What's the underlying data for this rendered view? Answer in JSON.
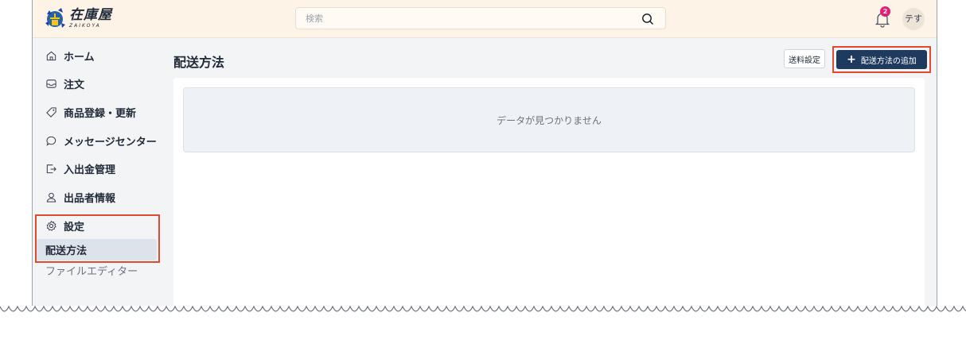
{
  "header": {
    "logo_main": "在庫屋",
    "logo_sub": "ZAIKOYA",
    "search_placeholder": "検索",
    "notification_count": "2",
    "avatar_label": "テす"
  },
  "sidebar": {
    "items": [
      {
        "label": "ホーム",
        "icon": "home-icon"
      },
      {
        "label": "注文",
        "icon": "inbox-icon"
      },
      {
        "label": "商品登録・更新",
        "icon": "tag-icon"
      },
      {
        "label": "メッセージセンター",
        "icon": "chat-icon"
      },
      {
        "label": "入出金管理",
        "icon": "transfer-icon"
      },
      {
        "label": "出品者情報",
        "icon": "user-icon"
      },
      {
        "label": "設定",
        "icon": "gear-icon"
      }
    ],
    "sub_items": [
      {
        "label": "配送方法",
        "active": true
      },
      {
        "label": "ファイルエディター",
        "active": false
      }
    ]
  },
  "main": {
    "title": "配送方法",
    "fee_button": "送料設定",
    "add_button": "配送方法の追加",
    "empty_message": "データが見つかりません"
  },
  "colors": {
    "header_bg": "#fdf3e6",
    "primary_button": "#1e3a5f",
    "highlight": "#e04a2f",
    "badge": "#e11d74"
  }
}
